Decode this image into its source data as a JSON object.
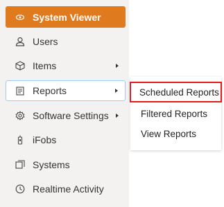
{
  "sidebar": {
    "items": [
      {
        "label": "System Viewer",
        "icon": "eye-icon",
        "active": true
      },
      {
        "label": "Users",
        "icon": "user-icon"
      },
      {
        "label": "Items",
        "icon": "box-icon",
        "submenu": true
      },
      {
        "label": "Reports",
        "icon": "report-icon",
        "submenu": true,
        "selected": true
      },
      {
        "label": "Software Settings",
        "icon": "gear-icon",
        "submenu": true
      },
      {
        "label": "iFobs",
        "icon": "fob-icon"
      },
      {
        "label": "Systems",
        "icon": "systems-icon"
      },
      {
        "label": "Realtime Activity",
        "icon": "clock-icon"
      }
    ]
  },
  "flyout": {
    "items": [
      {
        "label": "Scheduled Reports",
        "highlighted": true
      },
      {
        "label": "Filtered Reports"
      },
      {
        "label": "View Reports"
      }
    ]
  },
  "colors": {
    "active_bg": "#e07a1f",
    "selected_border": "#a9c7ea",
    "highlight_border": "#e51b1b"
  }
}
